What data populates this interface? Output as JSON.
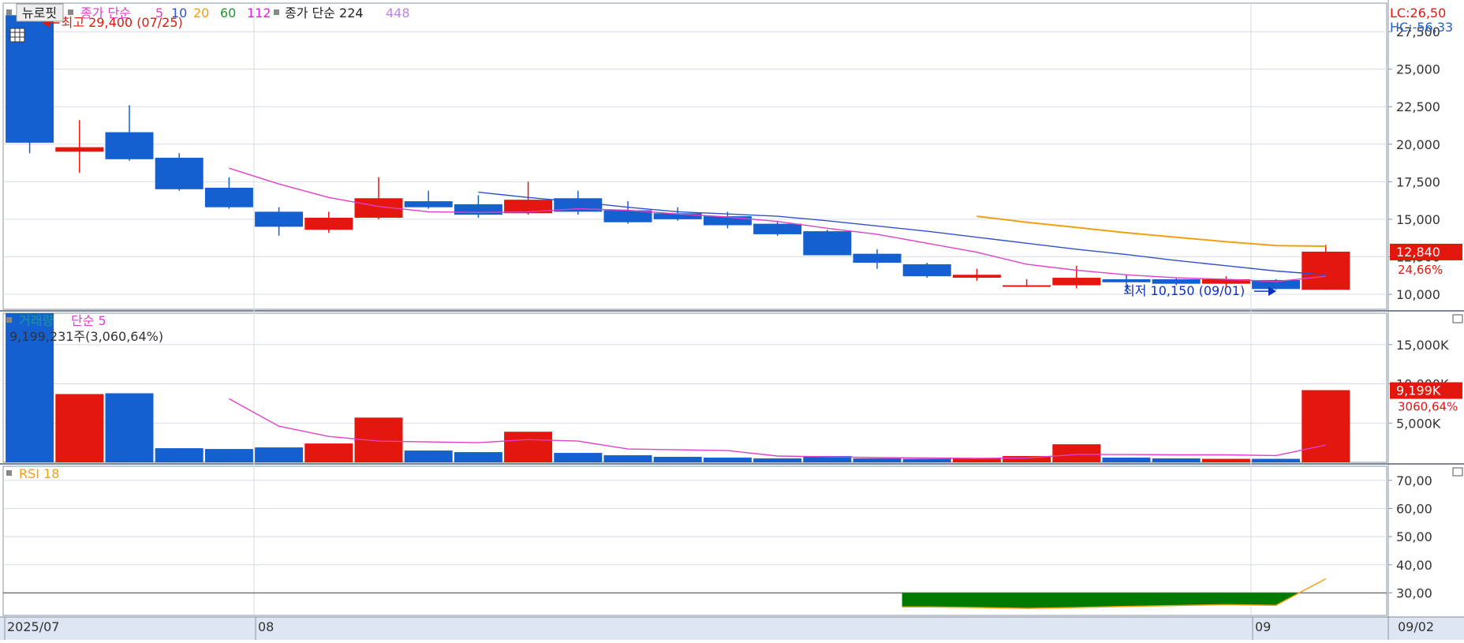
{
  "colors": {
    "up": "#e3170d",
    "down": "#1560d0",
    "ma5": "#e040c8",
    "ma10": "#3050d0",
    "ma20": "#f0a010",
    "ma60": "#1a9a2a",
    "ma112": "#e020e0",
    "ma224": "#222222",
    "ma448": "#c080f0",
    "vol_ma": "#e040c8",
    "rsi_line": "#f0a010",
    "rsi_fill": "#007a00",
    "grid": "#d6dbe6",
    "axis_bg": "#dde6f2"
  },
  "header": {
    "stock_button": "뉴로핏",
    "ma_label": "종가 단순",
    "ma_periods_a": [
      "5",
      "10",
      "20",
      "60",
      "112"
    ],
    "ma_label_b": "종가 단순 224",
    "ma_period_b": "448",
    "lc": "LC:26,50",
    "hc": "HC:-56,33",
    "icon": "grid-icon"
  },
  "chart_data": [
    {
      "type": "candlestick",
      "name": "price",
      "ylim": [
        9000,
        29400
      ],
      "y_ticks": [
        10000,
        12500,
        15000,
        17500,
        20000,
        22500,
        25000,
        27500
      ],
      "y_tick_labels": [
        "10,000",
        "12,500",
        "15,000",
        "17,500",
        "20,000",
        "22,500",
        "25,000",
        "27,500"
      ],
      "candles": [
        {
          "o": 28600,
          "h": 29400,
          "l": 19400,
          "c": 20100
        },
        {
          "o": 19500,
          "h": 21600,
          "l": 18100,
          "c": 19800
        },
        {
          "o": 20800,
          "h": 22600,
          "l": 18900,
          "c": 19000
        },
        {
          "o": 19100,
          "h": 19400,
          "l": 16900,
          "c": 17000
        },
        {
          "o": 17100,
          "h": 17800,
          "l": 15700,
          "c": 15800
        },
        {
          "o": 15500,
          "h": 15800,
          "l": 13900,
          "c": 14500
        },
        {
          "o": 14300,
          "h": 15500,
          "l": 14100,
          "c": 15100
        },
        {
          "o": 15100,
          "h": 17800,
          "l": 15000,
          "c": 16400
        },
        {
          "o": 16200,
          "h": 16900,
          "l": 15700,
          "c": 15800
        },
        {
          "o": 16000,
          "h": 16600,
          "l": 15100,
          "c": 15300
        },
        {
          "o": 15400,
          "h": 17500,
          "l": 15300,
          "c": 16300
        },
        {
          "o": 16400,
          "h": 16900,
          "l": 15300,
          "c": 15500
        },
        {
          "o": 15600,
          "h": 16200,
          "l": 14700,
          "c": 14800
        },
        {
          "o": 15400,
          "h": 15800,
          "l": 14900,
          "c": 15000
        },
        {
          "o": 15200,
          "h": 15500,
          "l": 14400,
          "c": 14600
        },
        {
          "o": 14700,
          "h": 14900,
          "l": 13900,
          "c": 14000
        },
        {
          "o": 14200,
          "h": 14300,
          "l": 12600,
          "c": 12600
        },
        {
          "o": 12700,
          "h": 13000,
          "l": 11700,
          "c": 12100
        },
        {
          "o": 12000,
          "h": 12100,
          "l": 11100,
          "c": 11200
        },
        {
          "o": 11100,
          "h": 11700,
          "l": 10900,
          "c": 11300
        },
        {
          "o": 10600,
          "h": 11000,
          "l": 10500,
          "c": 10600
        },
        {
          "o": 10600,
          "h": 11900,
          "l": 10400,
          "c": 11100
        },
        {
          "o": 11000,
          "h": 11300,
          "l": 10150,
          "c": 10800
        },
        {
          "o": 11000,
          "h": 11100,
          "l": 10600,
          "c": 10700
        },
        {
          "o": 10700,
          "h": 11200,
          "l": 10500,
          "c": 11000
        },
        {
          "o": 10950,
          "h": 11000,
          "l": 10300,
          "c": 10350
        },
        {
          "o": 10300,
          "h": 13300,
          "l": 10300,
          "c": 12840
        }
      ],
      "ma5": [
        null,
        null,
        null,
        null,
        18400,
        17350,
        16450,
        15850,
        15500,
        15450,
        15500,
        15700,
        15600,
        15350,
        15150,
        14850,
        14400,
        14000,
        13400,
        12800,
        12000,
        11600,
        11300,
        11100,
        11000,
        10850,
        11200
      ],
      "ma10": [
        null,
        null,
        null,
        null,
        null,
        null,
        null,
        null,
        null,
        16800,
        16450,
        16150,
        15800,
        15500,
        15350,
        15200,
        14900,
        14550,
        14200,
        13800,
        13400,
        13000,
        12650,
        12250,
        11900,
        11550,
        11300
      ],
      "ma20": [
        null,
        null,
        null,
        null,
        null,
        null,
        null,
        null,
        null,
        null,
        null,
        null,
        null,
        null,
        null,
        null,
        null,
        null,
        null,
        15200,
        14800,
        14450,
        14100,
        13800,
        13500,
        13250,
        13200
      ],
      "annotations": {
        "high": "최고 29,400 (07/25)",
        "low": "최저 10,150 (09/01)"
      },
      "last_price": "12,840",
      "last_change": "24,66%"
    },
    {
      "type": "bar",
      "name": "volume",
      "title": "거래량",
      "ma_label": "단순 5",
      "info": "9,199,231주(3,060,64%)",
      "ylim": [
        0,
        19000
      ],
      "y_ticks": [
        5000,
        10000,
        15000
      ],
      "y_tick_labels": [
        "5,000K",
        "10,000K",
        "15,000K"
      ],
      "values": [
        19500,
        8700,
        8800,
        1800,
        1700,
        1900,
        2400,
        5700,
        1500,
        1300,
        3900,
        1200,
        900,
        700,
        600,
        500,
        800,
        500,
        450,
        450,
        800,
        2300,
        600,
        500,
        450,
        450,
        9199
      ],
      "ma5": [
        null,
        null,
        null,
        null,
        8100,
        4600,
        3300,
        2700,
        2600,
        2500,
        2900,
        2700,
        1700,
        1600,
        1500,
        800,
        700,
        600,
        550,
        500,
        550,
        1000,
        1000,
        960,
        950,
        860,
        2200
      ],
      "last_value": "9,199K",
      "last_change": "3060,64%"
    },
    {
      "type": "area",
      "name": "rsi",
      "title": "RSI 18",
      "ylim": [
        22,
        75
      ],
      "y_ticks": [
        30,
        40,
        50,
        60,
        70
      ],
      "y_tick_labels": [
        "30,00",
        "40,00",
        "50,00",
        "60,00",
        "70,00"
      ],
      "threshold": 30,
      "values": [
        null,
        null,
        null,
        null,
        null,
        null,
        null,
        null,
        null,
        null,
        null,
        null,
        null,
        null,
        null,
        null,
        null,
        null,
        25.0,
        24.8,
        24.5,
        24.8,
        25.2,
        25.5,
        25.8,
        25.6,
        35.0
      ]
    }
  ],
  "x_axis": {
    "labels": [
      {
        "index": 0,
        "text": "2025/07"
      },
      {
        "index": 5,
        "text": "08"
      },
      {
        "index": 25,
        "text": "09"
      }
    ],
    "right_label": "09/02"
  }
}
